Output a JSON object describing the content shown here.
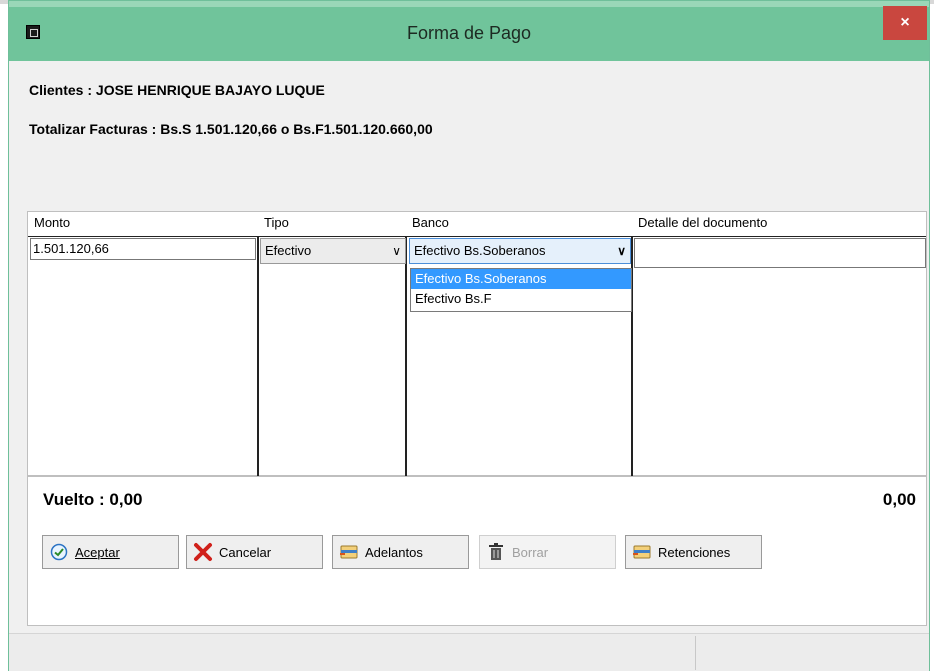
{
  "window": {
    "title": "Forma de Pago",
    "close_label": "×"
  },
  "info": {
    "clientes": "Clientes  : JOSE HENRIQUE BAJAYO LUQUE",
    "totalizar": "Totalizar Facturas  : Bs.S 1.501.120,66 o Bs.F1.501.120.660,00"
  },
  "grid": {
    "columns": [
      "Monto",
      "Tipo",
      "Banco",
      "Detalle del documento"
    ],
    "row": {
      "monto": "1.501.120,66",
      "tipo": "Efectivo",
      "banco": "Efectivo Bs.Soberanos",
      "detalle": ""
    },
    "banco_options": [
      "Efectivo Bs.Soberanos",
      "Efectivo Bs.F"
    ]
  },
  "panel": {
    "vuelto_label": "Vuelto : 0,00",
    "vuelto_value": "0,00"
  },
  "buttons": {
    "aceptar": "Aceptar",
    "cancelar": "Cancelar",
    "adelantos": "Adelantos",
    "borrar": "Borrar",
    "retenciones": "Retenciones"
  },
  "colors": {
    "titlebar": "#70c49b",
    "close": "#c9473f",
    "selection": "#3399ff"
  }
}
